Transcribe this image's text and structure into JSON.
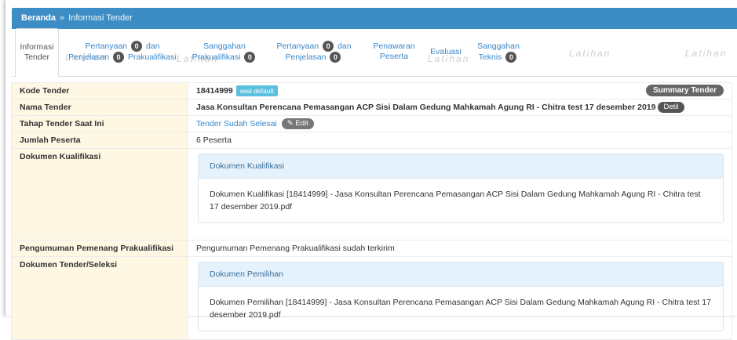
{
  "breadcrumb": {
    "home": "Beranda",
    "separator": "»",
    "current": "Informasi Tender"
  },
  "tabs": [
    {
      "line1": "Informasi",
      "line2": "Tender"
    },
    {
      "line1": "Pertanyaan",
      "badge1": "0",
      "after1": "dan",
      "line2": "Penjelasan",
      "badge2": "0",
      "after2": "Prakualifikasi"
    },
    {
      "line1": "Sanggahan",
      "line2": "Prakualifikasi",
      "badge2": "0"
    },
    {
      "line1": "Pertanyaan",
      "badge1": "0",
      "after1": "dan",
      "line2": "Penjelasan",
      "badge2": "0"
    },
    {
      "line1": "Penawaran",
      "line2": "Peserta"
    },
    {
      "line1": "Evaluasi"
    },
    {
      "line1": "Sanggahan",
      "line2": "Teknis",
      "badge2": "0"
    }
  ],
  "watermark": "Latihan",
  "rows": {
    "kode": {
      "label": "Kode Tender",
      "value": "18414999",
      "badge": "sesi default",
      "button": "Summary Tender"
    },
    "nama": {
      "label": "Nama Tender",
      "value": "Jasa Konsultan Perencana Pemasangan ACP Sisi Dalam Gedung Mahkamah Agung RI - Chitra test 17 desember 2019",
      "button": "Detil"
    },
    "tahap": {
      "label": "Tahap Tender Saat Ini",
      "value": "Tender Sudah Selesai",
      "button": "Edit"
    },
    "jumlah": {
      "label": "Jumlah Peserta",
      "value": "6 Peserta"
    },
    "dokKual": {
      "label": "Dokumen Kualifikasi",
      "panel_title": "Dokumen Kualifikasi",
      "file": "Dokumen Kualifikasi [18414999] - Jasa Konsultan Perencana Pemasangan ACP Sisi Dalam Gedung Mahkamah Agung RI - Chitra test 17 desember 2019.pdf"
    },
    "pengumuman": {
      "label": "Pengumuman Pemenang Prakualifikasi",
      "value": "Pengumuman Pemenang Prakualifikasi sudah terkirim"
    },
    "dokTender": {
      "label": "Dokumen Tender/Seleksi",
      "panel_title": "Dokumen Pemilihan",
      "file": "Dokumen Pemilihan [18414999] - Jasa Konsultan Perencana Pemasangan ACP Sisi Dalam Gedung Mahkamah Agung RI - Chitra test 17 desember 2019.pdf"
    }
  },
  "colors": {
    "header": "#3c8dc5",
    "label_bg": "#fdf7e3",
    "link": "#3a87c8",
    "panel_bg": "#e6f2fb"
  }
}
